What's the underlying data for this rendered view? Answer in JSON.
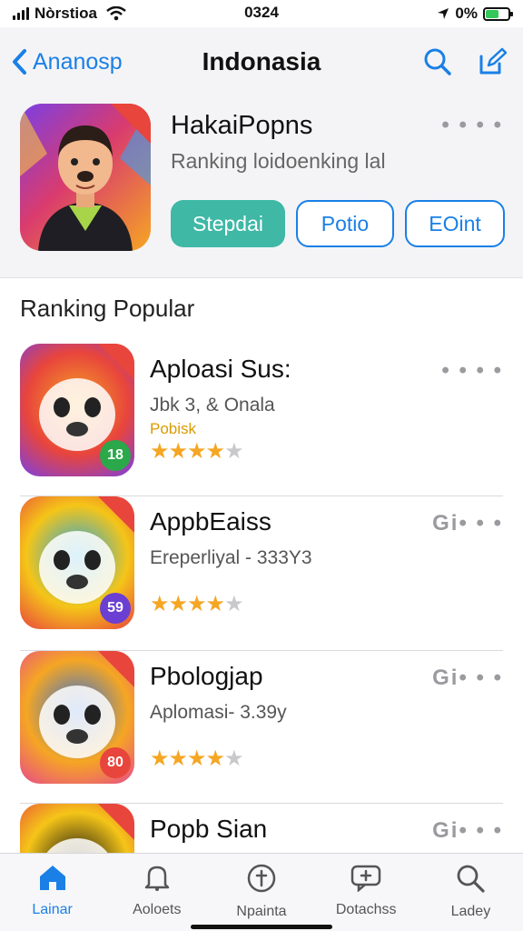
{
  "status": {
    "carrier": "Nòrstioa",
    "time": "0324",
    "battery": "0%"
  },
  "nav": {
    "back_label": "Ananosp",
    "title": "Indonasia"
  },
  "featured": {
    "name": "HakaiPopns",
    "subtitle": "Ranking loidoenking lal",
    "more": "• • • •",
    "buttons": {
      "primary": "Stepdai",
      "secondary": "Potio",
      "tertiary": "EOint"
    }
  },
  "section_title": "Ranking Popular",
  "apps": [
    {
      "name": "Aploasi Sus:",
      "sub": "Jbk 3, & Onala",
      "sub2": "Pobisk",
      "rating": 3.5,
      "more": "• • • •",
      "badge": "18",
      "badge_color": "#2aa84a",
      "icon_palette": [
        "#f5a623",
        "#e8453c",
        "#7b3fe4"
      ]
    },
    {
      "name": "AppbEaiss",
      "sub": "Ereperliyal - 333Y3",
      "sub2": "",
      "rating": 3.5,
      "more": "Gi• • •",
      "badge": "59",
      "badge_color": "#6b3fd1",
      "icon_palette": [
        "#1aa3e8",
        "#f5c518",
        "#e8453c"
      ]
    },
    {
      "name": "Pbologjap",
      "sub": "Aplomasi- 3.39y",
      "sub2": "",
      "rating": 4,
      "more": "Gi• • •",
      "badge": "80",
      "badge_color": "#e8453c",
      "icon_palette": [
        "#2a6fe0",
        "#f5a623",
        "#e84a8a"
      ]
    },
    {
      "name": "Popb Sian",
      "sub": "",
      "sub2": "",
      "rating": 0,
      "more": "Gi• • •",
      "badge": "",
      "badge_color": "#111111",
      "icon_palette": [
        "#111111",
        "#f5c518",
        "#e8453c"
      ]
    }
  ],
  "tabs": [
    {
      "label": "Lainar",
      "icon": "home-icon",
      "active": true
    },
    {
      "label": "Aoloets",
      "icon": "bell-icon",
      "active": false
    },
    {
      "label": "Npainta",
      "icon": "cross-circle-icon",
      "active": false
    },
    {
      "label": "Dotachss",
      "icon": "message-plus-icon",
      "active": false
    },
    {
      "label": "Ladey",
      "icon": "search-icon",
      "active": false
    }
  ],
  "colors": {
    "accent": "#1a80e6",
    "primary_button": "#3fb8a6",
    "star": "#f5a623"
  }
}
